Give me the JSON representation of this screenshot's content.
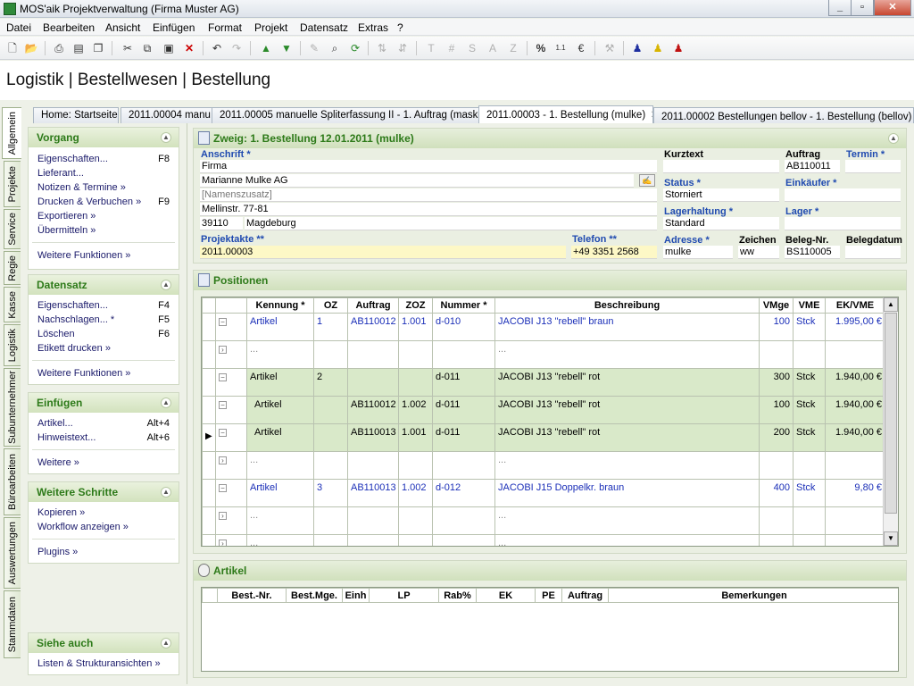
{
  "window": {
    "title": "MOS'aik Projektverwaltung (Firma Muster AG)"
  },
  "menu": [
    "Datei",
    "Bearbeiten",
    "Ansicht",
    "Einfügen",
    "Format",
    "Projekt",
    "Datensatz",
    "Extras",
    "?"
  ],
  "breadcrumb": "Logistik | Bestellwesen | Bestellung",
  "vertical_tabs": [
    "Allgemein",
    "Projekte",
    "Service",
    "Regie",
    "Kasse",
    "Logistik",
    "Subunternehmer",
    "Büroarbeiten",
    "Auswertungen",
    "Stammdaten"
  ],
  "doc_tabs": [
    {
      "label": "Home: Startseite"
    },
    {
      "label": "2011.00004 manu"
    },
    {
      "label": "2011.00005 manuelle Spliterfassung II - 1. Auftrag (maske)"
    },
    {
      "label": "2011.00003 - 1. Bestellung (mulke)",
      "active": true
    },
    {
      "label": "2011.00002 Bestellungen bellov - 1. Bestellung (bellov)"
    }
  ],
  "sidebar": {
    "vorgang": {
      "title": "Vorgang",
      "items": [
        {
          "label": "Eigenschaften...",
          "key": "F8"
        },
        {
          "label": "Lieferant...",
          "key": ""
        },
        {
          "label": "Notizen & Termine »",
          "key": ""
        },
        {
          "label": "Drucken & Verbuchen »",
          "key": "F9"
        },
        {
          "label": "Exportieren »",
          "key": ""
        },
        {
          "label": "Übermitteln »",
          "key": ""
        }
      ],
      "more": "Weitere Funktionen »"
    },
    "datensatz": {
      "title": "Datensatz",
      "items": [
        {
          "label": "Eigenschaften...",
          "key": "F4"
        },
        {
          "label": "Nachschlagen... *",
          "key": "F5"
        },
        {
          "label": "Löschen",
          "key": "F6"
        },
        {
          "label": "Etikett drucken »",
          "key": ""
        }
      ],
      "more": "Weitere Funktionen »"
    },
    "einfuegen": {
      "title": "Einfügen",
      "items": [
        {
          "label": "Artikel...",
          "key": "Alt+4"
        },
        {
          "label": "Hinweistext...",
          "key": "Alt+6"
        }
      ],
      "more": "Weitere »"
    },
    "weitere": {
      "title": "Weitere Schritte",
      "items": [
        {
          "label": "Kopieren »"
        },
        {
          "label": "Workflow anzeigen »"
        }
      ],
      "more": "Plugins »"
    },
    "siehe": {
      "title": "Siehe auch",
      "items": [
        {
          "label": "Listen & Strukturansichten »"
        }
      ]
    }
  },
  "zweig": {
    "title": "Zweig: 1. Bestellung 12.01.2011 (mulke)",
    "anschrift_label": "Anschrift *",
    "anschrift": [
      "Firma",
      "Marianne Mulke AG",
      "[Namenszusatz]",
      "Mellinstr. 77-81"
    ],
    "plz": "39110",
    "ort": "Magdeburg",
    "projektakte_label": "Projektakte **",
    "projektakte": "2011.00003",
    "telefon_label": "Telefon **",
    "telefon": "+49 3351 2568",
    "kurztext_label": "Kurztext",
    "kurztext": "",
    "auftrag_label": "Auftrag",
    "auftrag": "AB110011",
    "termin_label": "Termin *",
    "termin": "",
    "status_label": "Status *",
    "status": "Storniert",
    "einkaeufer_label": "Einkäufer *",
    "einkaeufer": "",
    "lagerhaltung_label": "Lagerhaltung *",
    "lagerhaltung": "Standard",
    "lager_label": "Lager *",
    "lager": "",
    "adresse_label": "Adresse *",
    "adresse": "mulke",
    "zeichen_label": "Zeichen",
    "zeichen": "ww",
    "belegnr_label": "Beleg-Nr.",
    "belegnr": "BS110005",
    "belegdatum_label": "Belegdatum",
    "belegdatum": ""
  },
  "positionen": {
    "title": "Positionen",
    "columns": [
      "Kennung *",
      "OZ",
      "Auftrag",
      "ZOZ",
      "Nummer *",
      "Beschreibung",
      "VMge",
      "VME",
      "EK/VME"
    ],
    "rows": [
      {
        "kennung": "Artikel",
        "oz": "1",
        "auftrag": "AB110012",
        "zoz": "1.001",
        "nummer": "d-010",
        "beschreibung": "JACOBI J13 \"rebell\" braun",
        "vmge": "100",
        "vme": "Stck",
        "ek": "1.995,00 €",
        "style": "blue"
      },
      {
        "kennung": "...",
        "oz": "",
        "auftrag": "",
        "zoz": "",
        "nummer": "",
        "beschreibung": "...",
        "vmge": "",
        "vme": "",
        "ek": "",
        "style": "dots"
      },
      {
        "kennung": "Artikel",
        "oz": "2",
        "auftrag": "",
        "zoz": "",
        "nummer": "d-011",
        "beschreibung": "JACOBI J13 \"rebell\" rot",
        "vmge": "300",
        "vme": "Stck",
        "ek": "1.940,00 €",
        "style": "grn"
      },
      {
        "kennung": "Artikel",
        "oz": "",
        "auftrag": "AB110012",
        "zoz": "1.002",
        "nummer": "d-011",
        "beschreibung": "JACOBI J13 \"rebell\" rot",
        "vmge": "100",
        "vme": "Stck",
        "ek": "1.940,00 €",
        "style": "grn"
      },
      {
        "kennung": "Artikel",
        "oz": "",
        "auftrag": "AB110013",
        "zoz": "1.001",
        "nummer": "d-011",
        "beschreibung": "JACOBI J13 \"rebell\" rot",
        "vmge": "200",
        "vme": "Stck",
        "ek": "1.940,00 €",
        "style": "grn"
      },
      {
        "kennung": "...",
        "oz": "",
        "auftrag": "",
        "zoz": "",
        "nummer": "",
        "beschreibung": "...",
        "vmge": "",
        "vme": "",
        "ek": "",
        "style": "dots"
      },
      {
        "kennung": "Artikel",
        "oz": "3",
        "auftrag": "AB110013",
        "zoz": "1.002",
        "nummer": "d-012",
        "beschreibung": "JACOBI J15 Doppelkr. braun",
        "vmge": "400",
        "vme": "Stck",
        "ek": "9,80 €",
        "style": "blue"
      },
      {
        "kennung": "...",
        "oz": "",
        "auftrag": "",
        "zoz": "",
        "nummer": "",
        "beschreibung": "...",
        "vmge": "",
        "vme": "",
        "ek": "",
        "style": "dots"
      },
      {
        "kennung": "...",
        "oz": "",
        "auftrag": "",
        "zoz": "",
        "nummer": "",
        "beschreibung": "...",
        "vmge": "",
        "vme": "",
        "ek": "",
        "style": "dots"
      }
    ]
  },
  "artikel": {
    "title": "Artikel",
    "columns": [
      "Best.-Nr.",
      "Best.Mge.",
      "Einh",
      "LP",
      "Rab%",
      "EK",
      "PE",
      "Auftrag",
      "Bemerkungen"
    ]
  },
  "colors": {
    "accent_green": "#2d7a19",
    "label_blue": "#1f4ab0",
    "row_green": "#d9e9c9"
  }
}
